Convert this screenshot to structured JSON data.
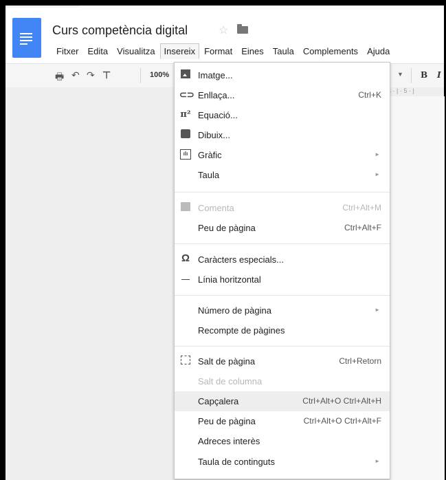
{
  "document": {
    "title": "Curs competència digital"
  },
  "menubar": [
    {
      "label": "Fitxer"
    },
    {
      "label": "Edita"
    },
    {
      "label": "Visualitza"
    },
    {
      "label": "Insereix"
    },
    {
      "label": "Format"
    },
    {
      "label": "Eines"
    },
    {
      "label": "Taula"
    },
    {
      "label": "Complements"
    },
    {
      "label": "Ajuda"
    }
  ],
  "toolbar": {
    "zoom": "100%",
    "bold": "B",
    "italic": "I"
  },
  "ruler": {
    "text": "4 · | · 5 · |"
  },
  "insert_menu": {
    "items": [
      {
        "label": "Imatge...",
        "icon": "image-icon",
        "shortcut": "",
        "enabled": true
      },
      {
        "label": "Enllaça...",
        "icon": "link-icon",
        "shortcut": "Ctrl+K",
        "enabled": true
      },
      {
        "label": "Equació...",
        "icon": "pi-icon",
        "shortcut": "",
        "enabled": true
      },
      {
        "label": "Dibuix...",
        "icon": "drawing-icon",
        "shortcut": "",
        "enabled": true
      },
      {
        "label": "Gràfic",
        "icon": "chart-icon",
        "shortcut": "",
        "enabled": true,
        "submenu": true
      },
      {
        "label": "Taula",
        "icon": "",
        "shortcut": "",
        "enabled": true,
        "submenu": true
      },
      {
        "label": "Comenta",
        "icon": "comment-icon",
        "shortcut": "Ctrl+Alt+M",
        "enabled": false
      },
      {
        "label": "Peu de pàgina",
        "icon": "",
        "shortcut": "Ctrl+Alt+F",
        "enabled": true
      },
      {
        "label": "Caràcters especials...",
        "icon": "omega-icon",
        "shortcut": "",
        "enabled": true
      },
      {
        "label": "Línia horitzontal",
        "icon": "horizontal-line-icon",
        "shortcut": "",
        "enabled": true
      },
      {
        "label": "Número de pàgina",
        "icon": "",
        "shortcut": "",
        "enabled": true,
        "submenu": true
      },
      {
        "label": "Recompte de pàgines",
        "icon": "",
        "shortcut": "",
        "enabled": true
      },
      {
        "label": "Salt de pàgina",
        "icon": "page-break-icon",
        "shortcut": "Ctrl+Retorn",
        "enabled": true
      },
      {
        "label": "Salt de columna",
        "icon": "",
        "shortcut": "",
        "enabled": false
      },
      {
        "label": "Capçalera",
        "icon": "",
        "shortcut": "Ctrl+Alt+O Ctrl+Alt+H",
        "enabled": true,
        "highlighted": true
      },
      {
        "label": "Peu de pàgina",
        "icon": "",
        "shortcut": "Ctrl+Alt+O Ctrl+Alt+F",
        "enabled": true
      },
      {
        "label": "Adreces interès",
        "icon": "",
        "shortcut": "",
        "enabled": true
      },
      {
        "label": "Taula de continguts",
        "icon": "",
        "shortcut": "",
        "enabled": true,
        "submenu": true
      }
    ]
  },
  "colors": {
    "docs_blue": "#4285f4",
    "menu_highlight": "#eeeeee",
    "disabled_text": "#b8b8b8"
  }
}
